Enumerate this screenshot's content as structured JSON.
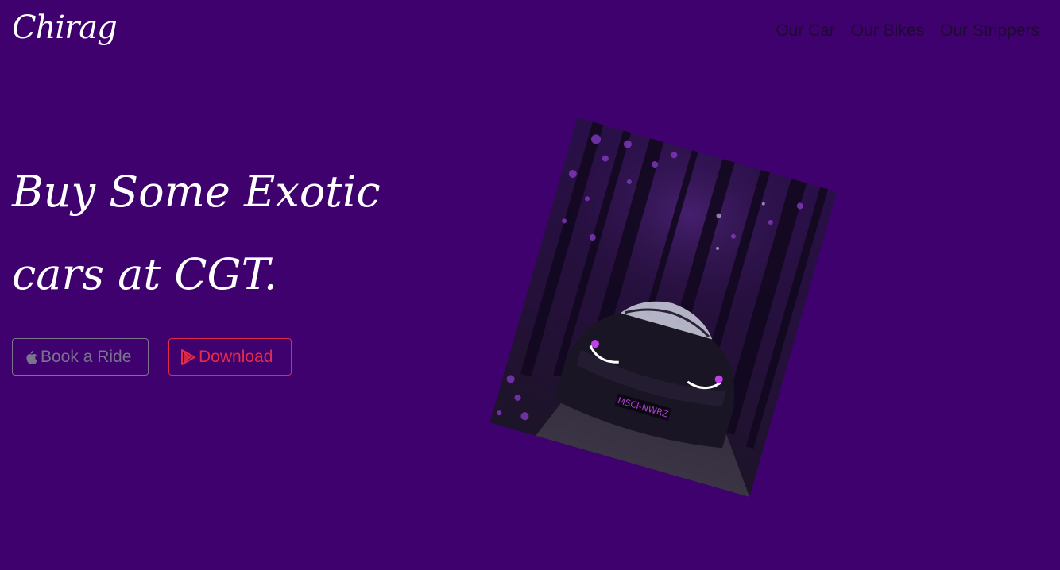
{
  "brand": "Chirag",
  "nav": [
    "Our Car",
    "Our Bikes",
    "Our Strippers"
  ],
  "hero": {
    "title": "Buy Some Exotic cars at CGT."
  },
  "buttons": {
    "book": "Book a Ride",
    "download": "Download"
  },
  "icons": {
    "book": "apple-icon",
    "download": "play-store-icon"
  },
  "image": {
    "plate": "MSCI-NWRZ"
  },
  "colors": {
    "background": "#3e016d",
    "download_accent": "#e52b4b",
    "book_accent": "#7a7490"
  }
}
